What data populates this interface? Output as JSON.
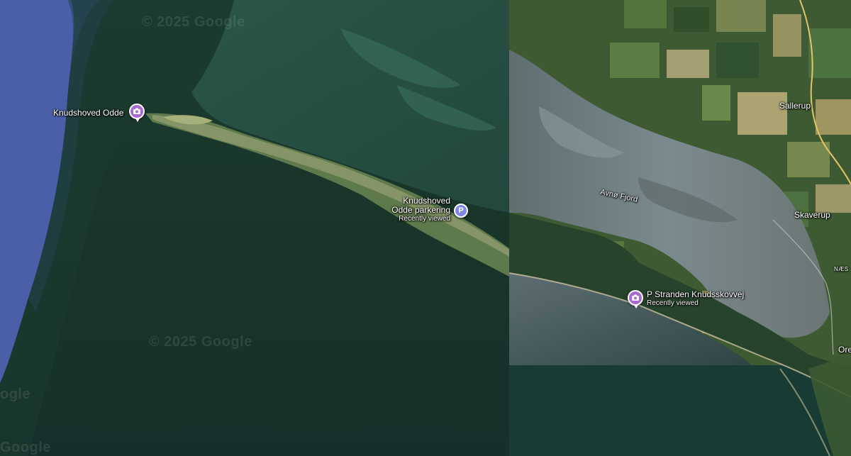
{
  "map": {
    "style": "satellite",
    "colors": {
      "deep_sea": "#17332c",
      "open_water_edge": "#4a5fa8",
      "shallow_water": "#2f5a4e",
      "fjord_water": "#7c8a90",
      "land": "#3f5a33",
      "field_light": "#9e9a6a",
      "road": "#e3c567"
    }
  },
  "watermarks": {
    "top": "© 2025 Google",
    "middle": "© 2025 Google",
    "left_edge": "ogle",
    "bottom_left": "Google"
  },
  "places": {
    "knudshoved_odde": {
      "name": "Knudshoved Odde",
      "icon": "camera-pin-icon"
    },
    "parking": {
      "name_line1": "Knudshoved",
      "name_line2": "Odde parkering",
      "subtitle": "Recently viewed",
      "icon_glyph": "P",
      "icon": "parking-pin-icon"
    },
    "stranden": {
      "name": "P Stranden Knudsskovvej",
      "subtitle": "Recently viewed",
      "icon": "camera-pin-icon"
    }
  },
  "area_labels": {
    "fjord": "Avnø Fjord",
    "sallerup": "Sallerup",
    "skaverup": "Skaverup",
    "naes": "NÆS",
    "ore": "Ore"
  }
}
